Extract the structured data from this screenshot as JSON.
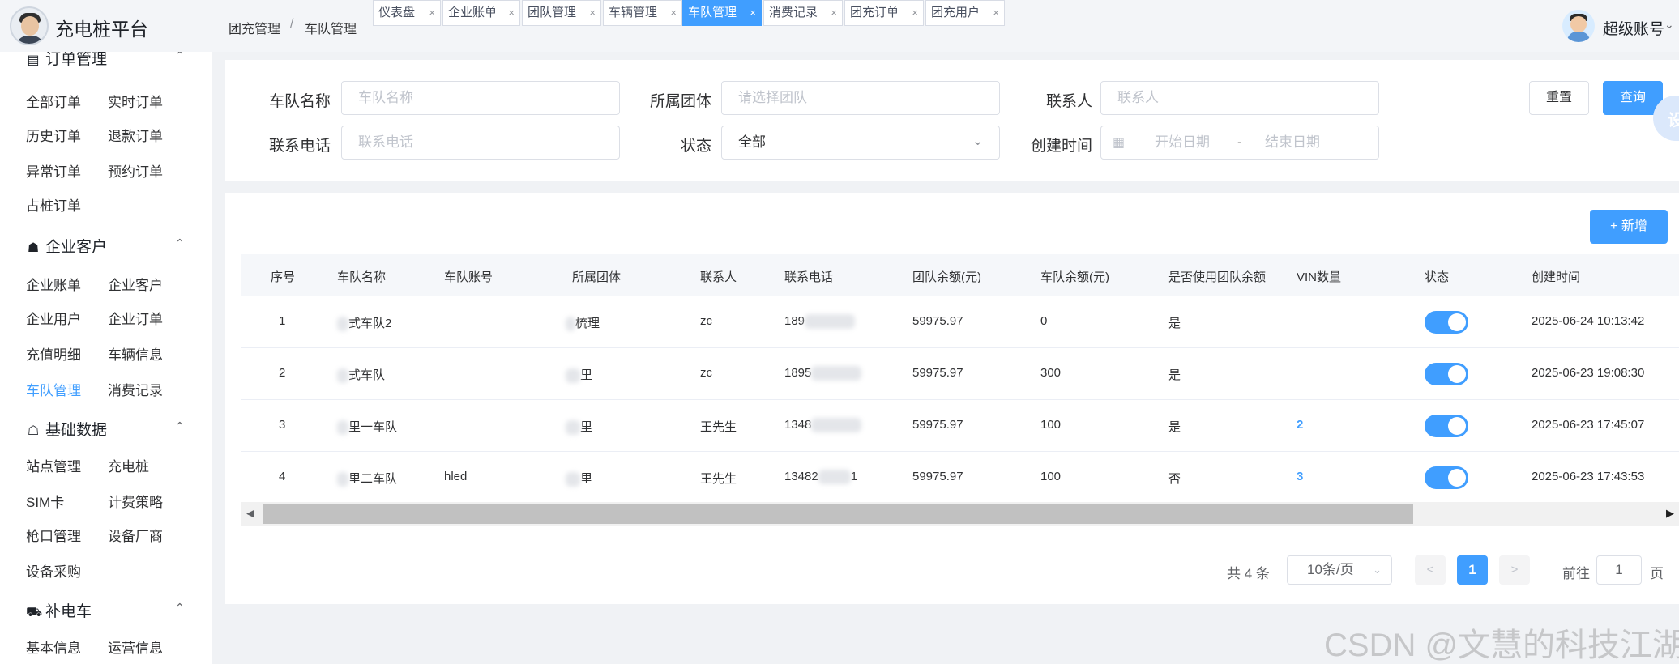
{
  "app": {
    "title": "充电桩平台"
  },
  "breadcrumb": [
    "团充管理",
    "车队管理"
  ],
  "breadcrumb_sep": "/",
  "tabs": [
    {
      "label": "仪表盘",
      "active": false
    },
    {
      "label": "企业账单",
      "active": false
    },
    {
      "label": "团队管理",
      "active": false
    },
    {
      "label": "车辆管理",
      "active": false
    },
    {
      "label": "车队管理",
      "active": true
    },
    {
      "label": "消费记录",
      "active": false
    },
    {
      "label": "团充订单",
      "active": false
    },
    {
      "label": "团充用户",
      "active": false
    }
  ],
  "tab_close": "×",
  "user": {
    "name": "超级账号",
    "caret": "⌄"
  },
  "sidebar": {
    "groups": [
      {
        "label": "订单管理",
        "icon": "order-list-icon",
        "items": [
          "全部订单",
          "实时订单",
          "历史订单",
          "退款订单",
          "异常订单",
          "预约订单",
          "占桩订单"
        ]
      },
      {
        "label": "企业客户",
        "icon": "users-icon",
        "items": [
          "企业账单",
          "企业客户",
          "企业用户",
          "企业订单",
          "充值明细",
          "车辆信息",
          "车队管理",
          "消费记录"
        ]
      },
      {
        "label": "基础数据",
        "icon": "router-icon",
        "items": [
          "站点管理",
          "充电桩",
          "SIM卡",
          "计费策略",
          "枪口管理",
          "设备厂商",
          "设备采购"
        ]
      },
      {
        "label": "补电车",
        "icon": "vehicle-icon",
        "items": [
          "基本信息",
          "运营信息"
        ]
      }
    ],
    "active_item": "车队管理",
    "chevron": "⌃"
  },
  "filters": {
    "fleet_name": {
      "label": "车队名称",
      "placeholder": "车队名称"
    },
    "group": {
      "label": "所属团体",
      "placeholder": "请选择团队"
    },
    "contact": {
      "label": "联系人",
      "placeholder": "联系人"
    },
    "phone": {
      "label": "联系电话",
      "placeholder": "联系电话"
    },
    "status": {
      "label": "状态",
      "value": "全部"
    },
    "created": {
      "label": "创建时间",
      "start_placeholder": "开始日期",
      "end_placeholder": "结束日期",
      "sep": "-"
    },
    "reset_label": "重置",
    "query_label": "查询"
  },
  "float_tool_label": "设",
  "add_button": "+ 新增",
  "table": {
    "columns": [
      "序号",
      "车队名称",
      "车队账号",
      "所属团体",
      "联系人",
      "联系电话",
      "团队余额(元)",
      "车队余额(元)",
      "是否使用团队余额",
      "VIN数量",
      "状态",
      "创建时间"
    ],
    "rows": [
      {
        "index": "1",
        "fleet_name": "式车队2",
        "account": "",
        "group": "梳理",
        "contact": "zc",
        "phone": "189",
        "team_balance": "59975.97",
        "fleet_balance": "0",
        "use_team": "是",
        "vin": "",
        "status_on": true,
        "created": "2025-06-24 10:13:42"
      },
      {
        "index": "2",
        "fleet_name": "式车队",
        "account": "",
        "group": "里",
        "contact": "zc",
        "phone": "1895",
        "team_balance": "59975.97",
        "fleet_balance": "300",
        "use_team": "是",
        "vin": "",
        "status_on": true,
        "created": "2025-06-23 19:08:30"
      },
      {
        "index": "3",
        "fleet_name": "里一车队",
        "account": "",
        "group": "里",
        "contact": "王先生",
        "phone": "1348",
        "team_balance": "59975.97",
        "fleet_balance": "100",
        "use_team": "是",
        "vin": "2",
        "status_on": true,
        "created": "2025-06-23 17:45:07"
      },
      {
        "index": "4",
        "fleet_name": "里二车队",
        "account": "hled",
        "group": "里",
        "contact": "王先生",
        "phone": "13482",
        "phone_tail": "1",
        "team_balance": "59975.97",
        "fleet_balance": "100",
        "use_team": "否",
        "vin": "3",
        "status_on": true,
        "created": "2025-06-23 17:43:53"
      }
    ]
  },
  "pagination": {
    "total": "共 4 条",
    "page_size": "10条/页",
    "prev": "<",
    "next": ">",
    "current": "1",
    "goto_label": "前往",
    "goto_value": "1",
    "page_suffix": "页"
  },
  "watermark": "CSDN @文慧的科技江湖"
}
